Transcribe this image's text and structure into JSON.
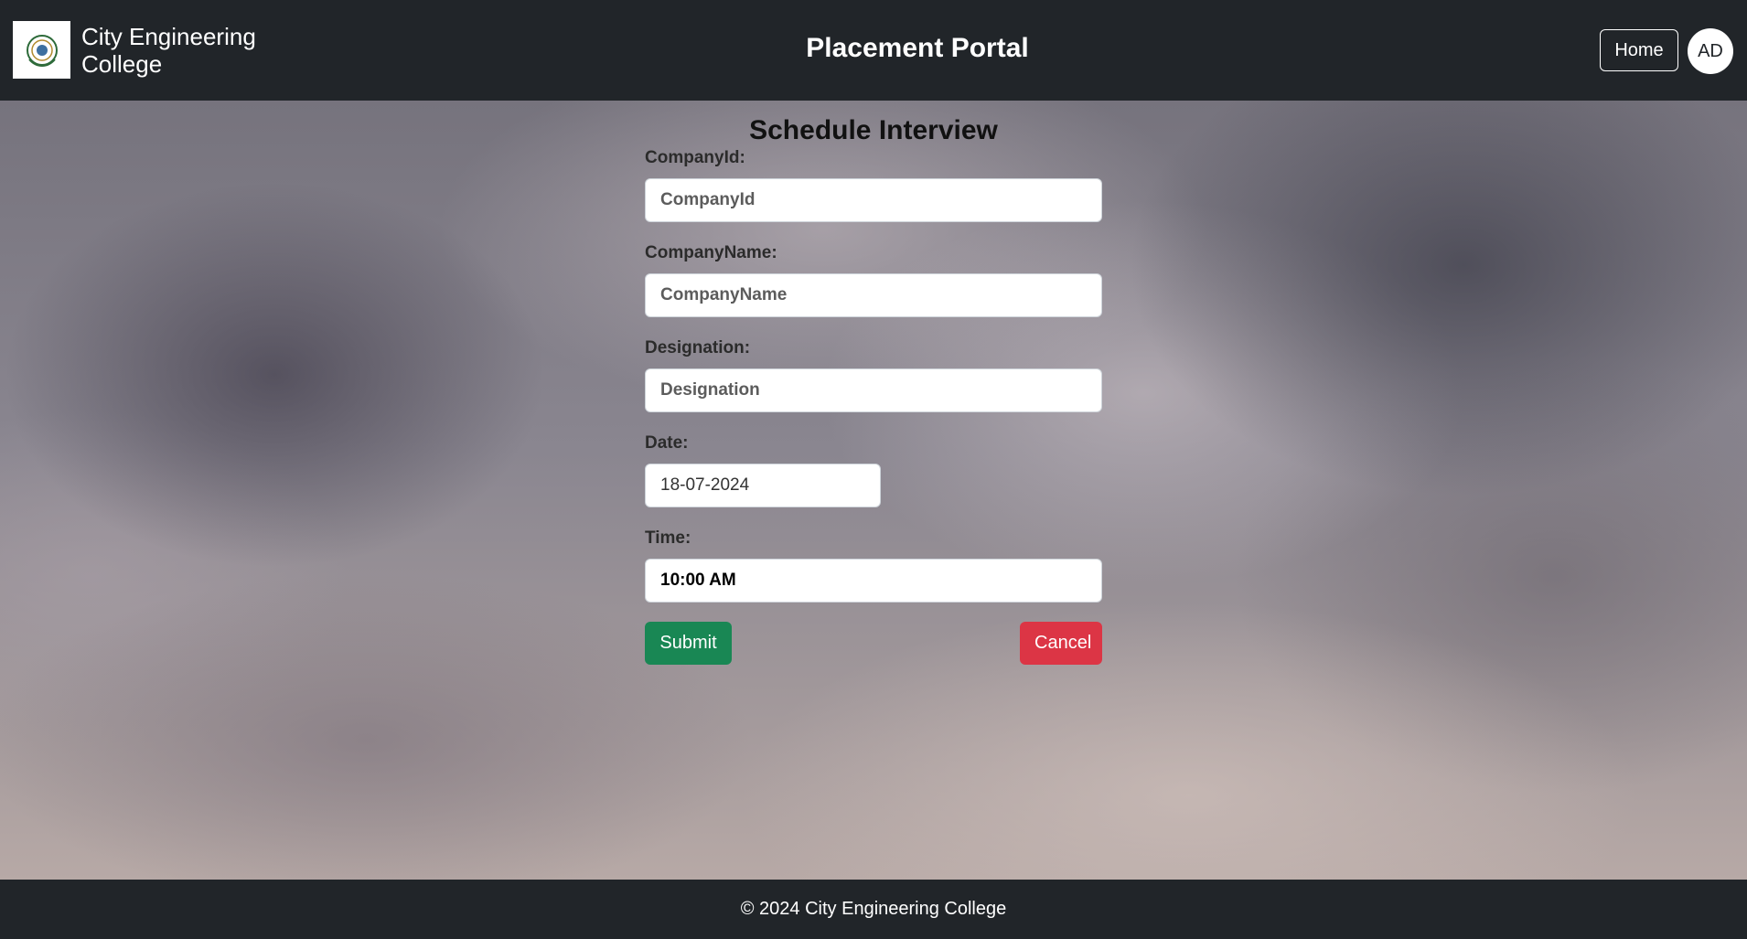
{
  "header": {
    "college_name": "City Engineering College",
    "portal_title": "Placement Portal",
    "home_label": "Home",
    "avatar_initials": "AD",
    "logo_icon": "college-emblem-icon"
  },
  "form": {
    "title": "Schedule Interview",
    "company_id": {
      "label": "CompanyId:",
      "placeholder": "CompanyId",
      "value": ""
    },
    "company_name": {
      "label": "CompanyName:",
      "placeholder": "CompanyName",
      "value": ""
    },
    "designation": {
      "label": "Designation:",
      "placeholder": "Designation",
      "value": ""
    },
    "date": {
      "label": "Date:",
      "value": "18-07-2024"
    },
    "time": {
      "label": "Time:",
      "value": "10:00 AM"
    },
    "submit_label": "Submit",
    "cancel_label": "Cancel"
  },
  "footer": {
    "text": "© 2024 City Engineering College"
  },
  "colors": {
    "navbar_bg": "#212529",
    "submit_bg": "#198754",
    "cancel_bg": "#dc3545"
  }
}
